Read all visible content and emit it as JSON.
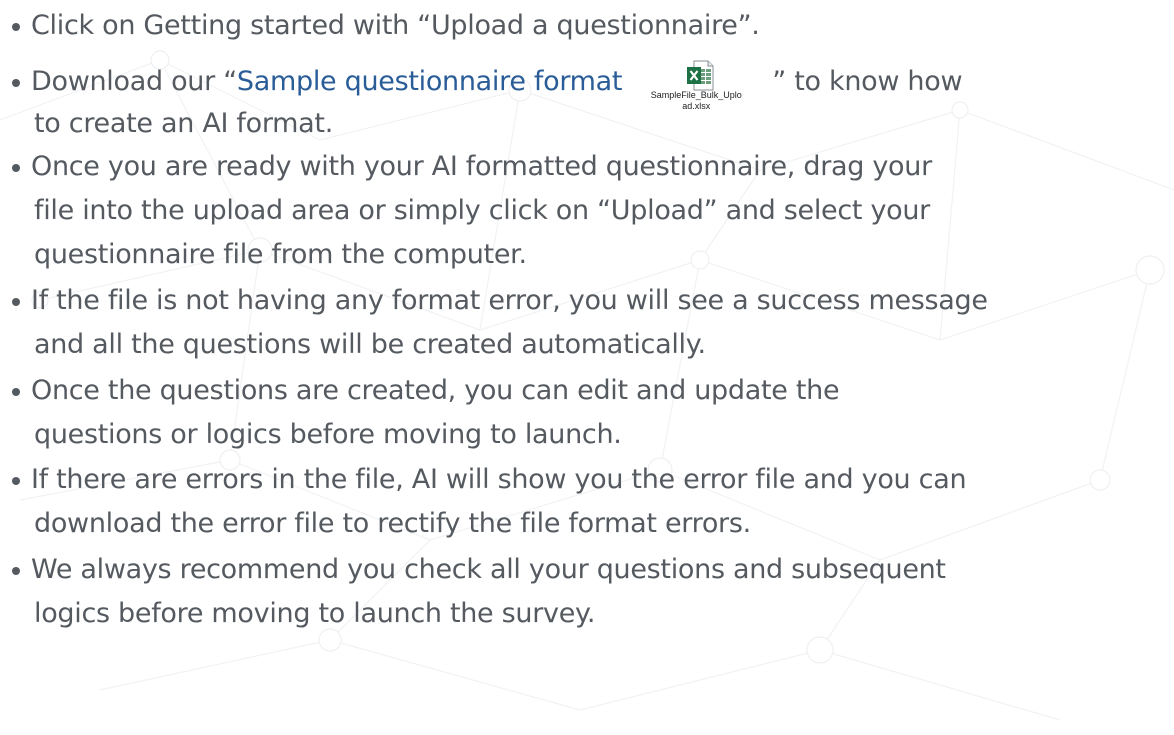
{
  "steps": [
    {
      "line1": "Click on Getting started with “Upload a questionnaire”."
    },
    {
      "prefix": "Download our “",
      "link_text": "Sample questionnaire format",
      "attachment_label_1": "SampleFile_Bulk_Uplo",
      "attachment_label_2": "ad.xlsx",
      "suffix": "” to know how",
      "line2": "to create an AI format."
    },
    {
      "line1": "Once you are ready with your AI formatted questionnaire, drag your",
      "line2": "file into the upload area or simply click on “Upload” and select your",
      "line3": "questionnaire file from the computer."
    },
    {
      "line1": "If the file is not having any format error, you will see a success message",
      "line2": "and all the questions will be created automatically."
    },
    {
      "line1": "Once the questions are created, you can edit and update the",
      "line2": "questions or logics before moving to launch."
    },
    {
      "line1": "If there are errors in the file, AI will show you the error file and you can",
      "line2": "download the error file to rectify the file format errors."
    },
    {
      "line1": "We always recommend you check all your questions and subsequent",
      "line2": "logics before moving to launch the survey."
    }
  ],
  "icons": {
    "attachment": "excel-file-icon",
    "bullet": "bullet-dot"
  },
  "colors": {
    "text": "#555a60",
    "link": "#2a5d98",
    "excel_green": "#1e7145"
  }
}
